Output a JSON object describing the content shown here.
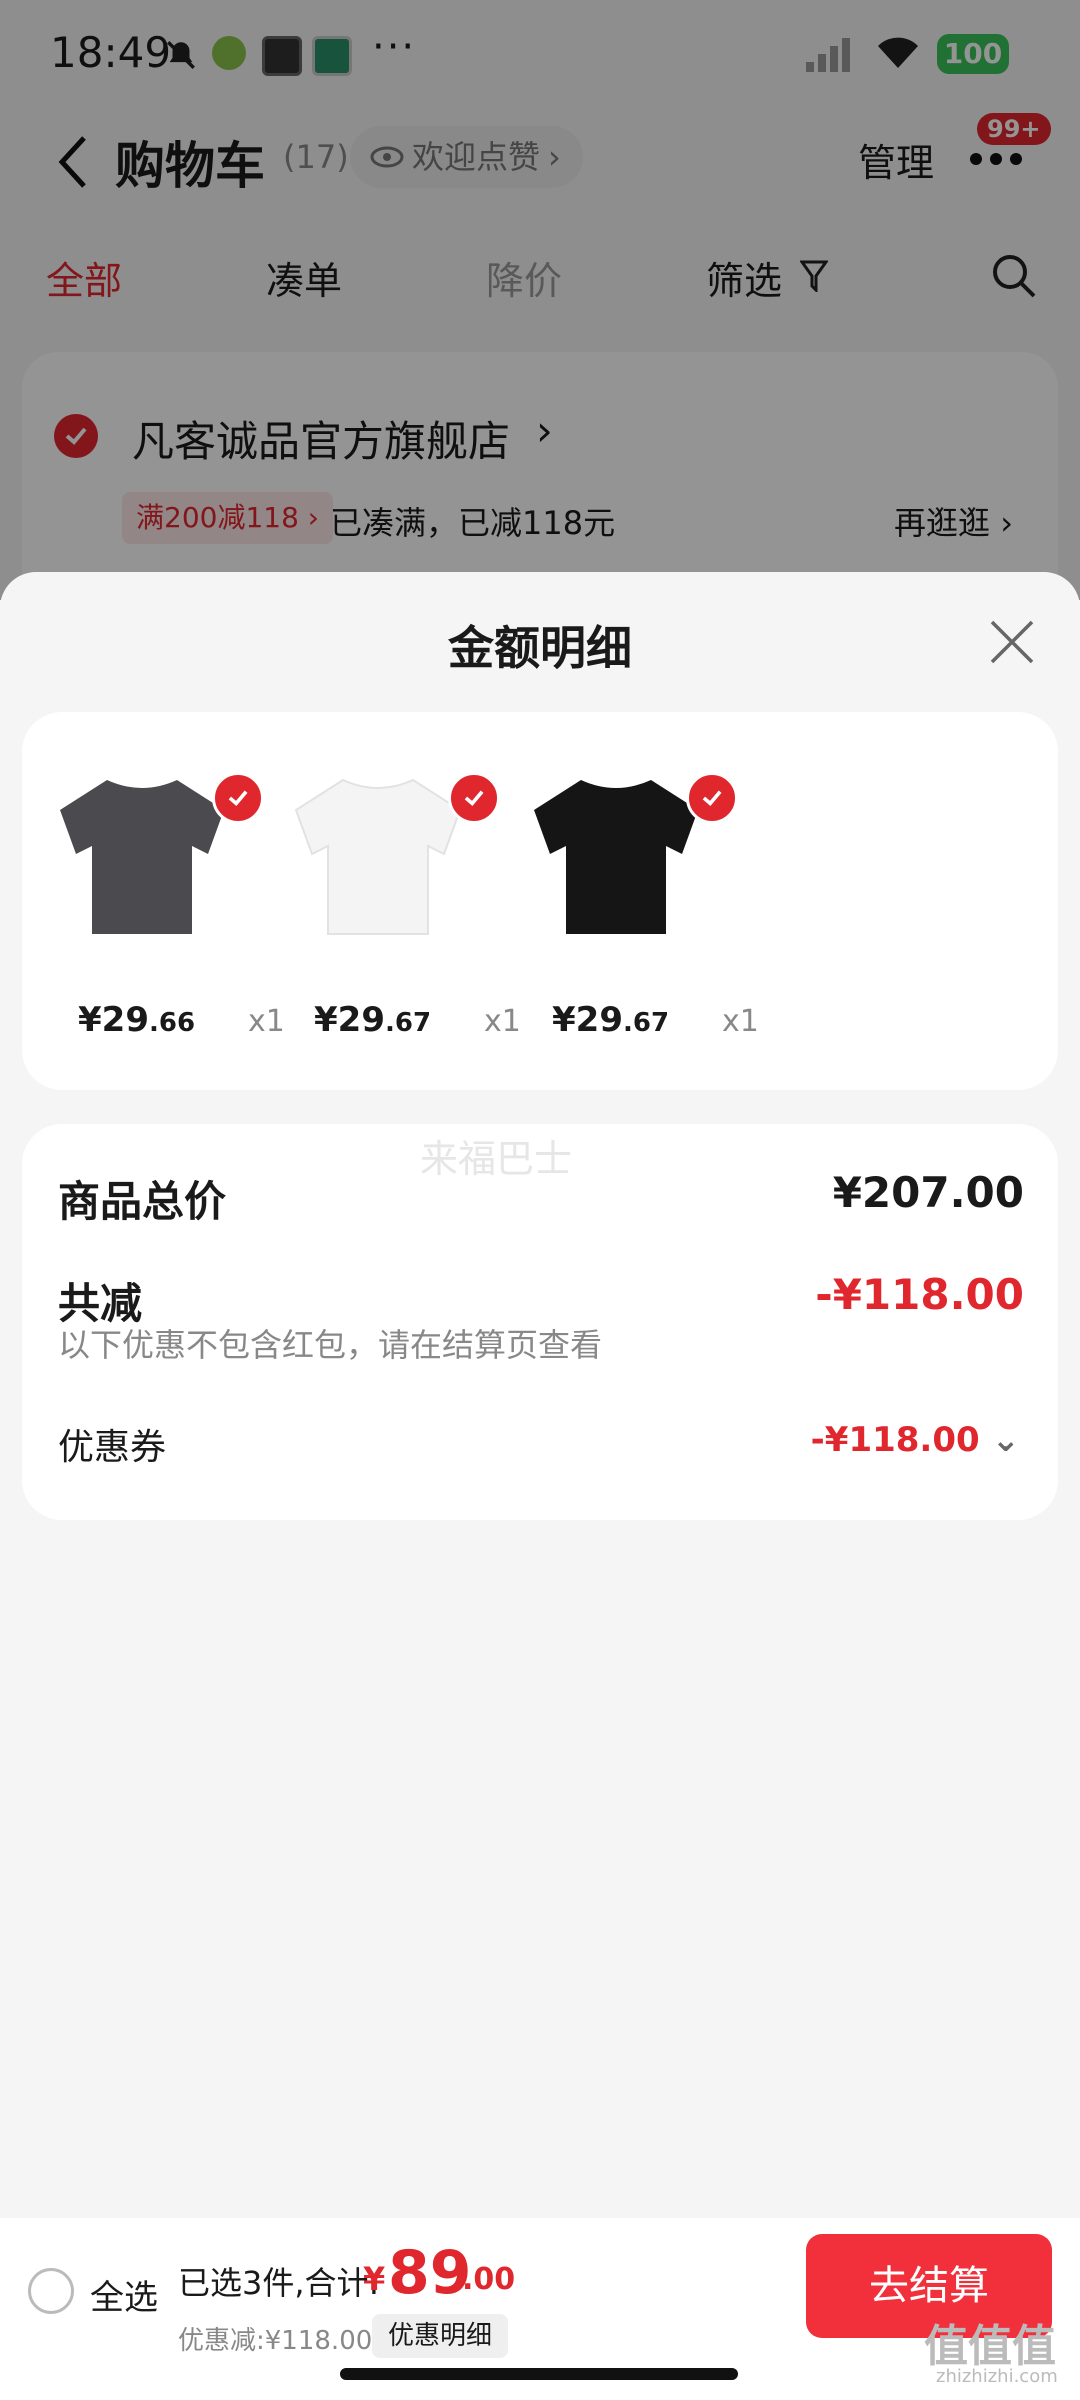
{
  "status_bar": {
    "time": "18:49",
    "battery": "100"
  },
  "header": {
    "title": "购物车",
    "count": "(17)",
    "pill_label": "欢迎点赞",
    "manage": "管理",
    "badge": "99+"
  },
  "tabs": [
    {
      "label": "全部",
      "active": true
    },
    {
      "label": "凑单"
    },
    {
      "label": "降价"
    },
    {
      "label": "筛选"
    }
  ],
  "store": {
    "name": "凡客诚品官方旗舰店",
    "promo_tag": "满200减118",
    "promo_text": "已凑满，已减118元",
    "browse": "再逛逛"
  },
  "sheet": {
    "title": "金额明细",
    "products": [
      {
        "price_int": "¥29",
        "price_dec": ".66",
        "qty": "x1",
        "color": "#4a4a4f"
      },
      {
        "price_int": "¥29",
        "price_dec": ".67",
        "qty": "x1",
        "color": "#f4f4f4"
      },
      {
        "price_int": "¥29",
        "price_dec": ".67",
        "qty": "x1",
        "color": "#151515"
      }
    ],
    "watermark": "来福巴士",
    "total_label": "商品总价",
    "total_value": "¥207.00",
    "reduce_label": "共减",
    "reduce_value": "-¥118.00",
    "note": "以下优惠不包含红包，请在结算页查看",
    "coupon_label": "优惠券",
    "coupon_value": "-¥118.00"
  },
  "bottom_bar": {
    "select_all": "全选",
    "selected_text": "已选3件,合计:",
    "currency": "¥",
    "total_int": "89",
    "total_dec": ".00",
    "discount_text": "优惠减:¥118.00",
    "detail_button": "优惠明细",
    "checkout": "去结算"
  },
  "corner_watermark": {
    "text": "值值值",
    "url": "zhizhizhi.com"
  },
  "colors": {
    "accent": "#e0272e",
    "checkout": "#f2303c"
  }
}
